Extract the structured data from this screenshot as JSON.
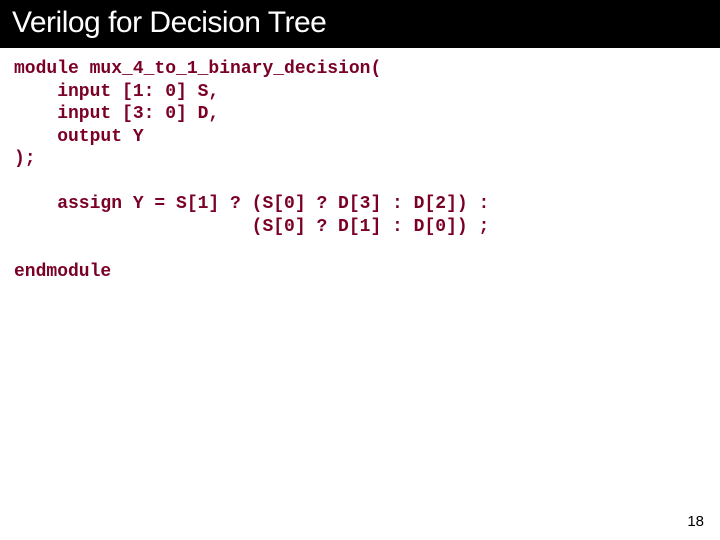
{
  "title": "Verilog for Decision Tree",
  "code": "module mux_4_to_1_binary_decision(\n    input [1: 0] S,\n    input [3: 0] D,\n    output Y\n);\n\n    assign Y = S[1] ? (S[0] ? D[3] : D[2]) :\n                      (S[0] ? D[1] : D[0]) ;\n\nendmodule",
  "page_number": "18"
}
